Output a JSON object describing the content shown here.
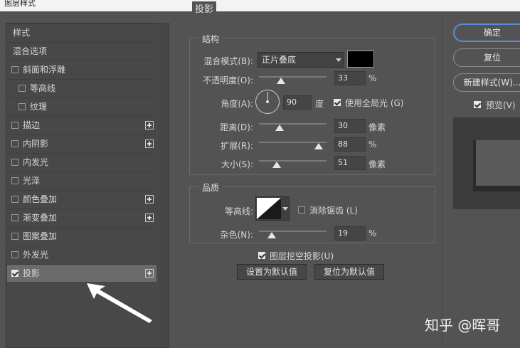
{
  "window": {
    "title": "图层样式"
  },
  "left_panel": {
    "items": [
      {
        "label": "样式",
        "checkbox": false,
        "checked": false,
        "plus": false,
        "sub": false,
        "selected": false
      },
      {
        "label": "混合选项",
        "checkbox": false,
        "checked": false,
        "plus": false,
        "sub": false,
        "selected": false
      },
      {
        "label": "斜面和浮雕",
        "checkbox": true,
        "checked": false,
        "plus": false,
        "sub": false,
        "selected": false
      },
      {
        "label": "等高线",
        "checkbox": true,
        "checked": false,
        "plus": false,
        "sub": true,
        "selected": false
      },
      {
        "label": "纹理",
        "checkbox": true,
        "checked": false,
        "plus": false,
        "sub": true,
        "selected": false
      },
      {
        "label": "描边",
        "checkbox": true,
        "checked": false,
        "plus": true,
        "sub": false,
        "selected": false
      },
      {
        "label": "内阴影",
        "checkbox": true,
        "checked": false,
        "plus": true,
        "sub": false,
        "selected": false
      },
      {
        "label": "内发光",
        "checkbox": true,
        "checked": false,
        "plus": false,
        "sub": false,
        "selected": false
      },
      {
        "label": "光泽",
        "checkbox": true,
        "checked": false,
        "plus": false,
        "sub": false,
        "selected": false
      },
      {
        "label": "颜色叠加",
        "checkbox": true,
        "checked": false,
        "plus": true,
        "sub": false,
        "selected": false
      },
      {
        "label": "渐变叠加",
        "checkbox": true,
        "checked": false,
        "plus": true,
        "sub": false,
        "selected": false
      },
      {
        "label": "图案叠加",
        "checkbox": true,
        "checked": false,
        "plus": false,
        "sub": false,
        "selected": false
      },
      {
        "label": "外发光",
        "checkbox": true,
        "checked": false,
        "plus": false,
        "sub": false,
        "selected": false
      },
      {
        "label": "投影",
        "checkbox": true,
        "checked": true,
        "plus": true,
        "sub": false,
        "selected": true
      }
    ]
  },
  "drop_shadow": {
    "title": "投影",
    "structure": {
      "title": "结构",
      "blend_mode": {
        "label": "混合模式(B):",
        "value": "正片叠底",
        "color": "#000000"
      },
      "opacity": {
        "label": "不透明度(O):",
        "value": "33",
        "unit": "%",
        "percent": 33
      },
      "angle": {
        "label": "角度(A):",
        "value": "90",
        "unit": "度",
        "global_light_label": "使用全局光 (G)",
        "global_light_checked": true
      },
      "distance": {
        "label": "距离(D):",
        "value": "30",
        "unit": "像素",
        "percent": 30
      },
      "spread": {
        "label": "扩展(R):",
        "value": "88",
        "unit": "%",
        "percent": 88
      },
      "size": {
        "label": "大小(S):",
        "value": "51",
        "unit": "像素",
        "percent": 26
      }
    },
    "quality": {
      "title": "品质",
      "contour_label": "等高线:",
      "anti_alias_label": "消除锯齿 (L)",
      "anti_alias_checked": false,
      "noise": {
        "label": "杂色(N):",
        "value": "19",
        "unit": "%",
        "percent": 19
      }
    },
    "knockout_label": "图层挖空投影(U)",
    "knockout_checked": true,
    "set_default_label": "设置为默认值",
    "reset_default_label": "复位为默认值"
  },
  "right_panel": {
    "ok_label": "确定",
    "reset_label": "复位",
    "new_style_label": "新建样式(W)...",
    "preview_label": "预览(V)",
    "preview_checked": true
  },
  "watermark": "知乎 @晖哥"
}
